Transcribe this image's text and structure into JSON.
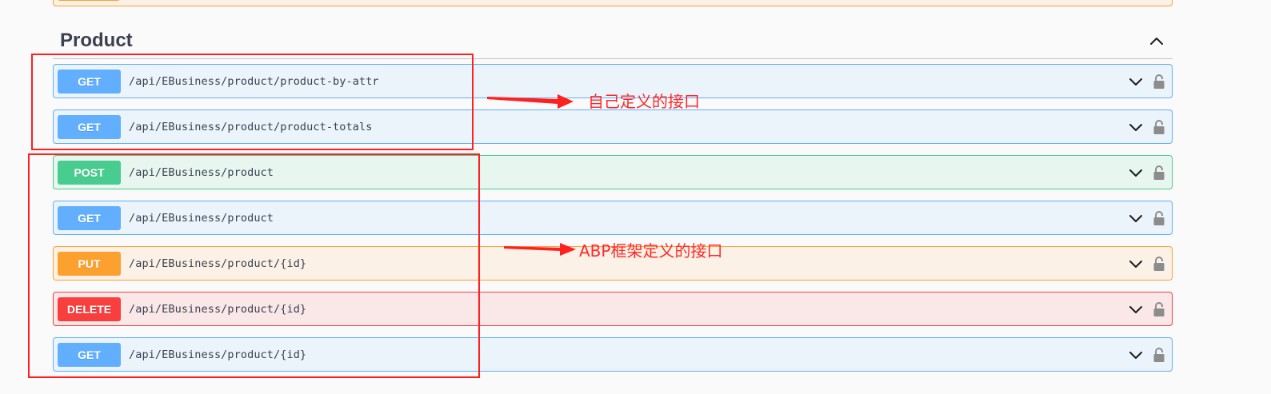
{
  "section": {
    "title": "Product"
  },
  "operations": [
    {
      "method": "GET",
      "path": "/api/EBusiness/product/product-by-attr"
    },
    {
      "method": "GET",
      "path": "/api/EBusiness/product/product-totals"
    },
    {
      "method": "POST",
      "path": "/api/EBusiness/product"
    },
    {
      "method": "GET",
      "path": "/api/EBusiness/product"
    },
    {
      "method": "PUT",
      "path": "/api/EBusiness/product/{id}"
    },
    {
      "method": "DELETE",
      "path": "/api/EBusiness/product/{id}"
    },
    {
      "method": "GET",
      "path": "/api/EBusiness/product/{id}"
    }
  ],
  "annotations": {
    "custom": "自己定义的接口",
    "abp": "ABP框架定义的接口"
  },
  "colors": {
    "get": "#61affe",
    "post": "#49cc90",
    "put": "#fca130",
    "delete": "#f93e3e",
    "annotation": "#ff2020"
  },
  "icons": {
    "collapse": "chevron-up-icon",
    "expand": "chevron-down-icon",
    "lock": "lock-icon"
  }
}
